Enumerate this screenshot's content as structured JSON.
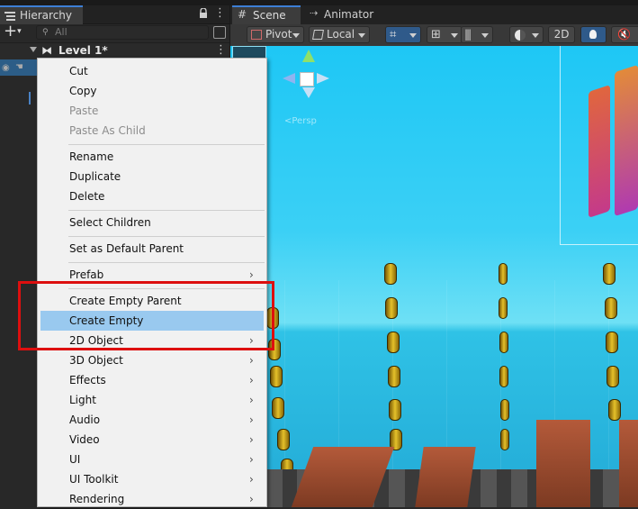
{
  "hierarchy": {
    "tab_label": "Hierarchy",
    "search_placeholder": "All",
    "add_label": "+",
    "scene_name": "Level 1*"
  },
  "scene_view": {
    "tabs": [
      {
        "label": "Scene",
        "icon": "grid-icon"
      },
      {
        "label": "Animator",
        "icon": "animator-icon"
      }
    ],
    "toolbar": {
      "pivot_label": "Pivot",
      "local_label": "Local",
      "twod_label": "2D"
    },
    "gizmo_label": "<Persp"
  },
  "context_menu": {
    "items": [
      {
        "label": "Cut",
        "enabled": true
      },
      {
        "label": "Copy",
        "enabled": true
      },
      {
        "label": "Paste",
        "enabled": false
      },
      {
        "label": "Paste As Child",
        "enabled": false
      },
      {
        "label": "Rename",
        "enabled": true
      },
      {
        "label": "Duplicate",
        "enabled": true
      },
      {
        "label": "Delete",
        "enabled": true
      },
      {
        "label": "Select Children",
        "enabled": true
      },
      {
        "label": "Set as Default Parent",
        "enabled": true
      },
      {
        "label": "Prefab",
        "enabled": true,
        "submenu": true
      },
      {
        "label": "Create Empty Parent",
        "enabled": true
      },
      {
        "label": "Create Empty",
        "enabled": true,
        "highlighted": true
      },
      {
        "label": "2D Object",
        "enabled": true,
        "submenu": true
      },
      {
        "label": "3D Object",
        "enabled": true,
        "submenu": true
      },
      {
        "label": "Effects",
        "enabled": true,
        "submenu": true
      },
      {
        "label": "Light",
        "enabled": true,
        "submenu": true
      },
      {
        "label": "Audio",
        "enabled": true,
        "submenu": true
      },
      {
        "label": "Video",
        "enabled": true,
        "submenu": true
      },
      {
        "label": "UI",
        "enabled": true,
        "submenu": true
      },
      {
        "label": "UI Toolkit",
        "enabled": true,
        "submenu": true
      },
      {
        "label": "Rendering",
        "enabled": true,
        "submenu": true
      }
    ],
    "submenu_arrow": "›",
    "highlight_color": "#99c9ef",
    "annotation_box_color": "#dd0f0f"
  }
}
